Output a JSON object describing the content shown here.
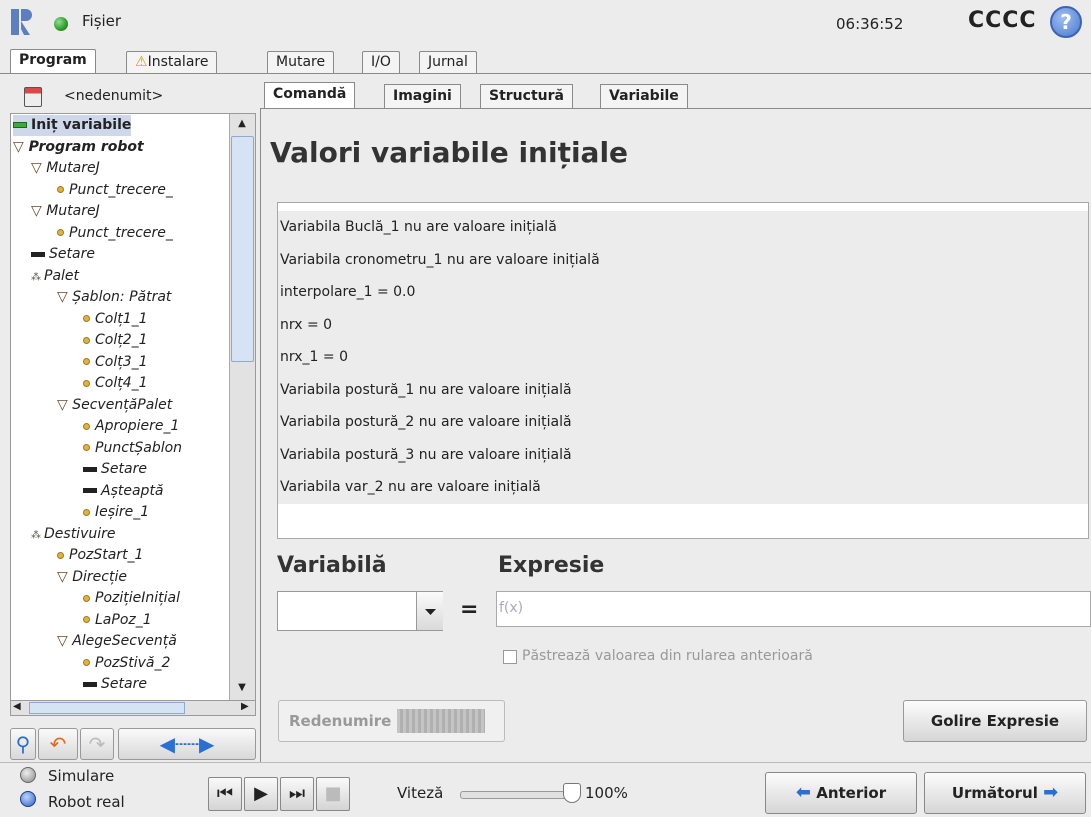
{
  "titlebar": {
    "file_menu": "Fișier",
    "clock": "06:36:52",
    "robot_name": "CCCC",
    "help": "?"
  },
  "main_tabs": [
    "Program",
    "Instalare",
    "Mutare",
    "I/O",
    "Jurnal"
  ],
  "program_file": {
    "name": "<nedenumit>"
  },
  "tree": [
    {
      "label": "Iniț variabile",
      "kind": "bar-green",
      "selected": true
    },
    {
      "label": "Program robot",
      "kind": "tri",
      "bold": true
    },
    {
      "label": "MutareJ",
      "kind": "tri"
    },
    {
      "label": "Punct_trecere_",
      "kind": "dot"
    },
    {
      "label": "MutareJ",
      "kind": "tri"
    },
    {
      "label": "Punct_trecere_",
      "kind": "dot"
    },
    {
      "label": "Setare",
      "kind": "bar"
    },
    {
      "label": "Palet",
      "kind": "pallet"
    },
    {
      "label": "Șablon: Pătrat",
      "kind": "tri"
    },
    {
      "label": "Colț1_1",
      "kind": "dot"
    },
    {
      "label": "Colț2_1",
      "kind": "dot"
    },
    {
      "label": "Colț3_1",
      "kind": "dot"
    },
    {
      "label": "Colț4_1",
      "kind": "dot"
    },
    {
      "label": "SecvențăPalet",
      "kind": "tri"
    },
    {
      "label": "Apropiere_1",
      "kind": "dot"
    },
    {
      "label": "PunctȘablon",
      "kind": "dot"
    },
    {
      "label": "Setare",
      "kind": "bar"
    },
    {
      "label": "Așteaptă",
      "kind": "bar"
    },
    {
      "label": "Ieșire_1",
      "kind": "dot"
    },
    {
      "label": "Destivuire",
      "kind": "pallet"
    },
    {
      "label": "PozStart_1",
      "kind": "dot"
    },
    {
      "label": "Direcție",
      "kind": "tri"
    },
    {
      "label": "PozițieInițial",
      "kind": "dot"
    },
    {
      "label": "LaPoz_1",
      "kind": "dot"
    },
    {
      "label": "AlegeSecvență",
      "kind": "tri"
    },
    {
      "label": "PozStivă_2",
      "kind": "dot"
    },
    {
      "label": "Setare",
      "kind": "bar"
    }
  ],
  "sub_tabs": [
    "Comandă",
    "Imagini",
    "Structură",
    "Variabile"
  ],
  "content": {
    "heading": "Valori variabile inițiale",
    "variables": [
      "Variabila Buclă_1 nu are valoare inițială",
      "Variabila cronometru_1 nu are valoare inițială",
      "interpolare_1 = 0.0",
      "nrx = 0",
      "nrx_1 = 0",
      "Variabila postură_1 nu are valoare inițială",
      "Variabila postură_2 nu are valoare inițială",
      "Variabila postură_3 nu are valoare inițială",
      "Variabila var_2 nu are valoare inițială"
    ],
    "variable_label": "Variabilă",
    "expression_label": "Expresie",
    "equals": "=",
    "expression_placeholder": "f(x)",
    "keep_value_label": "Păstrează valoarea din rularea anterioară",
    "rename_button": "Redenumire",
    "clear_button": "Golire Expresie"
  },
  "bottom": {
    "simulation": "Simulare",
    "real_robot": "Robot real",
    "speed_label": "Viteză",
    "speed_value": "100%",
    "speed_fraction": 1.0,
    "prev_button": "Anterior",
    "next_button": "Următorul"
  }
}
